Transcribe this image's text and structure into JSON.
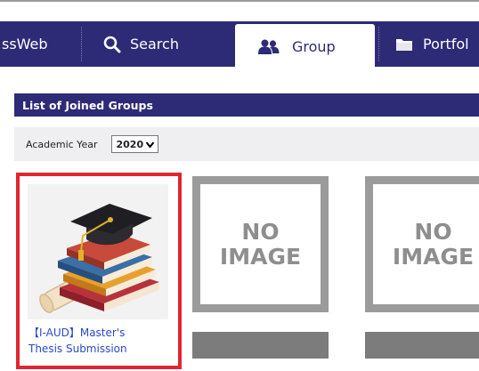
{
  "nav": {
    "tabs": [
      {
        "label": "ssWeb",
        "icon": "none"
      },
      {
        "label": "Search",
        "icon": "search-icon"
      },
      {
        "label": "Group",
        "icon": "group-icon",
        "active": true
      },
      {
        "label": "Portfol",
        "icon": "folder-icon"
      }
    ],
    "bg_color": "#2d2a76"
  },
  "section": {
    "title": "List of Joined Groups"
  },
  "filter": {
    "label": "Academic Year",
    "year": "2020"
  },
  "groups": [
    {
      "title_line1": "【I-AUD】Master's",
      "title_line2": "Thesis Submission",
      "image": "graduation-books"
    },
    {
      "placeholder_line1": "NO",
      "placeholder_line2": "IMAGE"
    },
    {
      "placeholder_line1": "NO",
      "placeholder_line2": "IMAGE"
    }
  ],
  "colors": {
    "selection": "#e0262e",
    "link": "#2a48c8",
    "placeholder": "#9b9b9b"
  }
}
